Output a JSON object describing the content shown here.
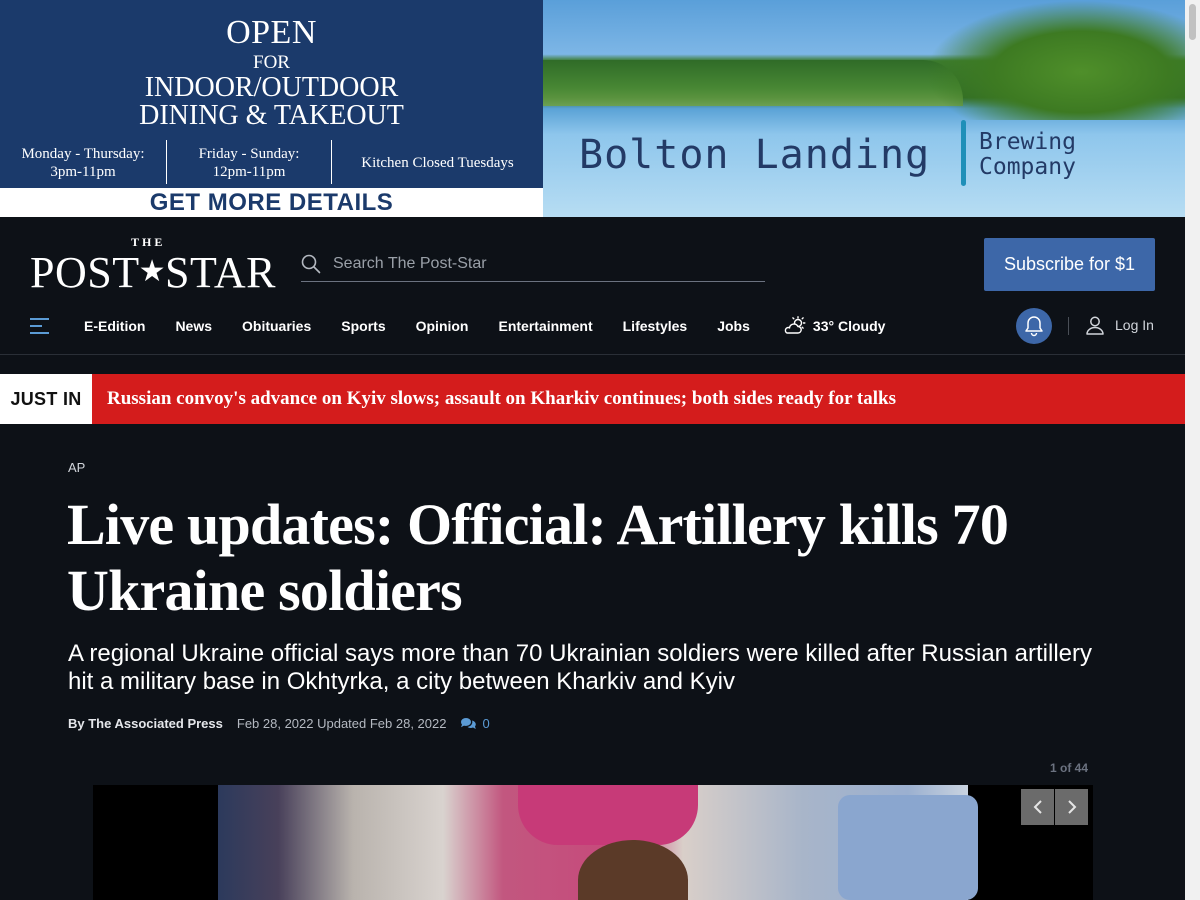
{
  "ad": {
    "open": "OPEN",
    "for": "FOR",
    "dining_line1": "INDOOR/OUTDOOR",
    "dining_line2": "DINING & TAKEOUT",
    "hours": [
      {
        "days": "Monday - Thursday:",
        "time": "3pm-11pm"
      },
      {
        "days": "Friday - Sunday:",
        "time": "12pm-11pm"
      }
    ],
    "closed": "Kitchen Closed Tuesdays",
    "cta": "GET MORE DETAILS",
    "brand": "Bolton Landing",
    "brand_sub1": "Brewing",
    "brand_sub2": "Company",
    "colors": {
      "navy": "#1b3a6b"
    }
  },
  "header": {
    "logo_the": "THE",
    "logo_left": "POST",
    "logo_star": "★",
    "logo_right": "STAR",
    "search_placeholder": "Search The Post-Star",
    "subscribe_label": "Subscribe for $1",
    "login_label": "Log In"
  },
  "nav": {
    "items": [
      "E-Edition",
      "News",
      "Obituaries",
      "Sports",
      "Opinion",
      "Entertainment",
      "Lifestyles",
      "Jobs"
    ],
    "weather": "33° Cloudy",
    "weather_icon": "partly-cloudy-icon"
  },
  "just_in": {
    "label": "JUST IN",
    "headline": "Russian convoy's advance on Kyiv slows; assault on Kharkiv continues; both sides ready for talks",
    "color": "#d41c1c"
  },
  "article": {
    "kicker": "AP",
    "headline": "Live updates: Official: Artillery kills 70 Ukraine soldiers",
    "dek": "A regional Ukraine official says more than 70 Ukrainian soldiers were killed after Russian artillery hit a military base in Okhtyrka, a city between Kharkiv and Kyiv",
    "byline": "By The Associated Press",
    "date": "Feb 28, 2022 Updated Feb 28, 2022",
    "comment_count": "0"
  },
  "gallery": {
    "counter": "1 of 44",
    "prev_icon": "chevron-left-icon",
    "next_icon": "chevron-right-icon"
  }
}
